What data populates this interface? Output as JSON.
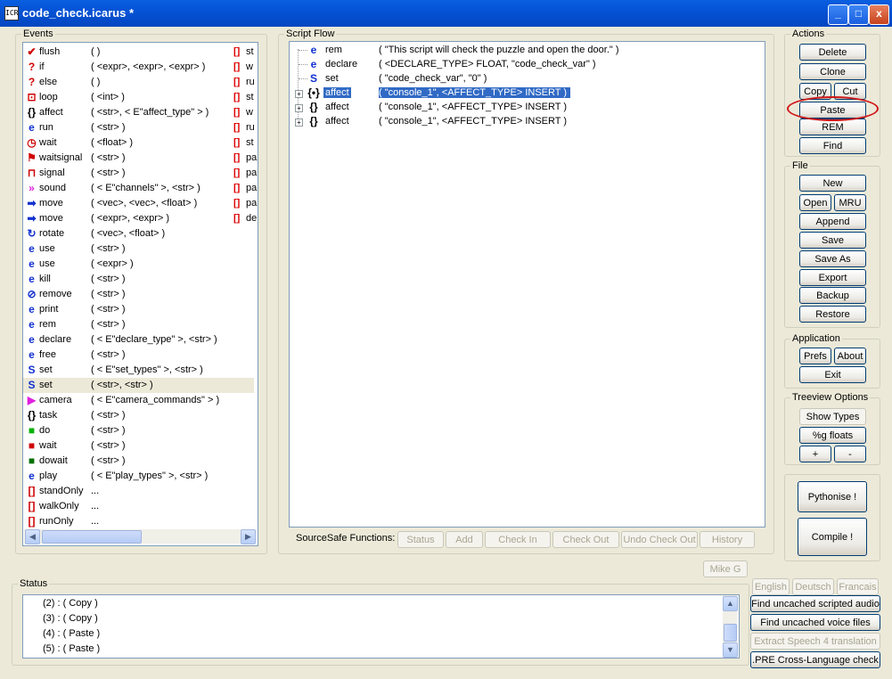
{
  "window": {
    "title": "code_check.icarus *",
    "title_icon": "app-icon",
    "buttons": {
      "minimize": "_",
      "maximize": "□",
      "close": "x"
    }
  },
  "events": {
    "label": "Events",
    "items": [
      {
        "icon": "flush-icon",
        "glyph": "✔",
        "color": "#d00000",
        "name": "flush",
        "args": "(   )"
      },
      {
        "icon": "if-icon",
        "glyph": "?",
        "color": "#d00000",
        "name": "if",
        "args": "( <expr>, <expr>, <expr> )"
      },
      {
        "icon": "else-icon",
        "glyph": "?",
        "color": "#d00000",
        "name": "else",
        "args": "(   )"
      },
      {
        "icon": "loop-icon",
        "glyph": "⊡",
        "color": "#d00000",
        "name": "loop",
        "args": "( <int> )"
      },
      {
        "icon": "affect-icon",
        "glyph": "{}",
        "color": "#000000",
        "name": "affect",
        "args": "( <str>, < E\"affect_type\" > )"
      },
      {
        "icon": "run-icon",
        "glyph": "e",
        "color": "#1030d0",
        "name": "run",
        "args": "( <str> )"
      },
      {
        "icon": "wait-icon",
        "glyph": "◷",
        "color": "#d00000",
        "name": "wait",
        "args": "( <float> )"
      },
      {
        "icon": "waitsignal-icon",
        "glyph": "⚑",
        "color": "#d00000",
        "name": "waitsignal",
        "args": "( <str> )"
      },
      {
        "icon": "signal-icon",
        "glyph": "⊓",
        "color": "#d00000",
        "name": "signal",
        "args": "( <str> )"
      },
      {
        "icon": "sound-icon",
        "glyph": "»",
        "color": "#e020e0",
        "name": "sound",
        "args": "( < E\"channels\" >, <str> )"
      },
      {
        "icon": "move-icon",
        "glyph": "➡",
        "color": "#1030d0",
        "name": "move",
        "args": "( <vec>, <vec>, <float> )"
      },
      {
        "icon": "move-icon",
        "glyph": "➡",
        "color": "#1030d0",
        "name": "move",
        "args": "( <expr>, <expr> )"
      },
      {
        "icon": "rotate-icon",
        "glyph": "↻",
        "color": "#1030d0",
        "name": "rotate",
        "args": "( <vec>, <float> )"
      },
      {
        "icon": "use-icon",
        "glyph": "e",
        "color": "#1030d0",
        "name": "use",
        "args": "( <str> )"
      },
      {
        "icon": "use-icon",
        "glyph": "e",
        "color": "#1030d0",
        "name": "use",
        "args": "( <expr> )"
      },
      {
        "icon": "kill-icon",
        "glyph": "e",
        "color": "#1030d0",
        "name": "kill",
        "args": "( <str> )"
      },
      {
        "icon": "remove-icon",
        "glyph": "⊘",
        "color": "#1030d0",
        "name": "remove",
        "args": "( <str> )"
      },
      {
        "icon": "print-icon",
        "glyph": "e",
        "color": "#1030d0",
        "name": "print",
        "args": "( <str> )"
      },
      {
        "icon": "rem-icon",
        "glyph": "e",
        "color": "#1030d0",
        "name": "rem",
        "args": "( <str> )"
      },
      {
        "icon": "declare-icon",
        "glyph": "e",
        "color": "#1030d0",
        "name": "declare",
        "args": "( < E\"declare_type\" >, <str> )"
      },
      {
        "icon": "free-icon",
        "glyph": "e",
        "color": "#1030d0",
        "name": "free",
        "args": "( <str> )"
      },
      {
        "icon": "set-icon",
        "glyph": "S",
        "color": "#1030d0",
        "name": "set",
        "args": "( < E\"set_types\" >, <str> )"
      },
      {
        "icon": "set-icon",
        "glyph": "S",
        "color": "#1030d0",
        "name": "set",
        "args": "( <str>, <str> )"
      },
      {
        "icon": "camera-icon",
        "glyph": "▶",
        "color": "#e020e0",
        "name": "camera",
        "args": "( < E\"camera_commands\" > )"
      },
      {
        "icon": "task-icon",
        "glyph": "{}",
        "color": "#000000",
        "name": "task",
        "args": "( <str> )"
      },
      {
        "icon": "do-icon",
        "glyph": "■",
        "color": "#00b000",
        "name": "do",
        "args": "( <str> )"
      },
      {
        "icon": "wait-block-icon",
        "glyph": "■",
        "color": "#d00000",
        "name": "wait",
        "args": "( <str> )"
      },
      {
        "icon": "dowait-icon",
        "glyph": "■",
        "color": "#007000",
        "name": "dowait",
        "args": "( <str> )"
      },
      {
        "icon": "play-icon",
        "glyph": "e",
        "color": "#1030d0",
        "name": "play",
        "args": "( < E\"play_types\" >, <str> )"
      },
      {
        "icon": "bracket-icon",
        "glyph": "[]",
        "color": "#d00000",
        "name": "standOnly",
        "args": "..."
      },
      {
        "icon": "bracket-icon",
        "glyph": "[]",
        "color": "#d00000",
        "name": "walkOnly",
        "args": "..."
      },
      {
        "icon": "bracket-icon",
        "glyph": "[]",
        "color": "#d00000",
        "name": "runOnly",
        "args": "..."
      }
    ],
    "col2": [
      "st",
      "w",
      "ru",
      "st",
      "w",
      "ru",
      "st",
      "pa",
      "pa",
      "pa",
      "pa",
      "de"
    ]
  },
  "script": {
    "label": "Script Flow",
    "rows": [
      {
        "expander": "",
        "icon": "rem-icon",
        "glyph": "e",
        "name": "rem",
        "args": "( \"This script will check the puzzle and open the door.\" )",
        "selected": false
      },
      {
        "expander": "",
        "icon": "declare-icon",
        "glyph": "e",
        "name": "declare",
        "args": "( <DECLARE_TYPE> FLOAT, \"code_check_var\" )",
        "selected": false
      },
      {
        "expander": "",
        "icon": "set-icon",
        "glyph": "S",
        "name": "set",
        "args": "( \"code_check_var\", \"0\" )",
        "selected": false
      },
      {
        "expander": "+",
        "icon": "affect-icon",
        "glyph": "{•}",
        "name": "affect",
        "args": "( \"console_1\", <AFFECT_TYPE> INSERT )",
        "selected": true
      },
      {
        "expander": "+",
        "icon": "affect-icon",
        "glyph": "{}",
        "name": "affect",
        "args": "( \"console_1\", <AFFECT_TYPE> INSERT )",
        "selected": false
      },
      {
        "expander": "+",
        "icon": "affect-icon",
        "glyph": "{}",
        "name": "affect",
        "args": "( \"console_1\", <AFFECT_TYPE> INSERT )",
        "selected": false
      }
    ],
    "sourcesafe": {
      "label": "SourceSafe Functions:",
      "buttons": [
        "Status",
        "Add",
        "Check In",
        "Check Out",
        "Undo Check Out",
        "History"
      ]
    }
  },
  "actions": {
    "label": "Actions",
    "delete": "Delete",
    "clone": "Clone",
    "copy": "Copy",
    "cut": "Cut",
    "paste": "Paste",
    "rem": "REM",
    "find": "Find"
  },
  "file": {
    "label": "File",
    "new": "New",
    "open": "Open",
    "mru": "MRU",
    "append": "Append",
    "save": "Save",
    "save_as": "Save As",
    "export": "Export",
    "backup": "Backup",
    "restore": "Restore"
  },
  "application": {
    "label": "Application",
    "prefs": "Prefs",
    "about": "About",
    "exit": "Exit"
  },
  "treeview": {
    "label": "Treeview Options",
    "show_types": "Show Types",
    "g_floats": "%g floats",
    "plus": "+",
    "minus": "-"
  },
  "tools": {
    "pythonise": "Pythonise !",
    "compile": "Compile !"
  },
  "user_button": "Mike G",
  "status": {
    "label": "Status",
    "lines": [
      "(2) : ( Copy )",
      "(3) : ( Copy )",
      "(4) : ( Paste )",
      "(5) : ( Paste )"
    ]
  },
  "language": {
    "english": "English",
    "deutsch": "Deutsch",
    "francais": "Francais"
  },
  "bottom_buttons": {
    "find_audio": "Find uncached scripted audio",
    "find_voice": "Find uncached voice files",
    "extract_speech": "Extract Speech 4 translation",
    "pre_check": ".PRE Cross-Language check"
  },
  "colors": {
    "selection": "#316ac5",
    "annotation": "#d00000",
    "titlebar": "#0553d6"
  }
}
